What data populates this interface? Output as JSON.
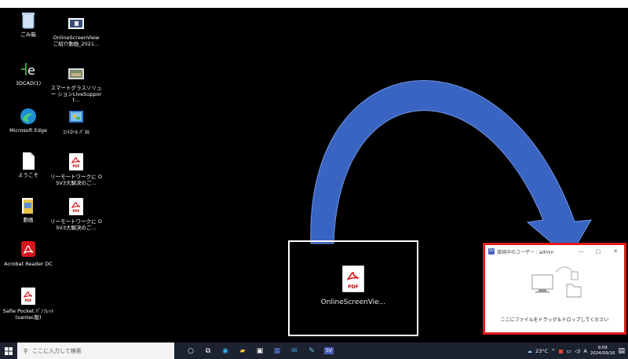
{
  "desktop": {
    "left_column": [
      {
        "label": "ごみ箱",
        "icon": "recycle-bin-icon"
      },
      {
        "label": "3DCAD(1)",
        "icon": "e-app-icon"
      },
      {
        "label": "Microsoft Edge",
        "icon": "edge-icon"
      },
      {
        "label": "ようこそ",
        "icon": "document-icon"
      },
      {
        "label": "動画",
        "icon": "video-folder-icon"
      },
      {
        "label": "Acrobat Reader DC",
        "icon": "acrobat-icon"
      },
      {
        "label": "Safie Pocket ﾊﾟﾝﾌﾚｯﾄ (santec版)",
        "icon": "pdf-icon"
      }
    ],
    "right_column": [
      {
        "label": "OnlineScreenView ご紹介動画_2021...",
        "icon": "video-thumbnail-icon"
      },
      {
        "label": "スマートグラスソリュー ションLiveSupport...",
        "icon": "video-thumbnail-icon"
      },
      {
        "label": "ｺﾝﾄﾛｰﾙ ﾊﾟﾈﾙ",
        "icon": "control-panel-icon"
      },
      {
        "label": "リーモートワークに OSV3大解決のご...",
        "icon": "pdf-icon"
      },
      {
        "label": "リーモートワークに OSV3大解決のご...",
        "icon": "pdf-icon"
      }
    ]
  },
  "pdf_tag": "PDF",
  "dragged_file": {
    "name": "OnlineScreenVie..."
  },
  "sv_window": {
    "logo": "SV",
    "title": "接続中のユーザー : admin",
    "minimize": "—",
    "maximize": "□",
    "close": "✕",
    "drop_message": "ここにファイルをドラッグ＆ドロップしてください"
  },
  "taskbar": {
    "search_placeholder": "ここに入力して検索",
    "apps": [
      {
        "icon": "cortana-icon",
        "glyph": "○"
      },
      {
        "icon": "task-view-icon",
        "glyph": "⧉"
      },
      {
        "icon": "edge-taskbar-icon",
        "glyph": "◉"
      },
      {
        "icon": "file-explorer-icon",
        "glyph": "▰"
      },
      {
        "icon": "store-icon",
        "glyph": "▣"
      },
      {
        "icon": "calendar-icon",
        "glyph": "▦"
      },
      {
        "icon": "mail-icon",
        "glyph": "✉"
      },
      {
        "icon": "notepad-icon",
        "glyph": "✎"
      },
      {
        "icon": "sv-app-icon",
        "glyph": "SV"
      }
    ],
    "weather": "23°C",
    "ime": "A",
    "time": "9:09",
    "date": "2024/09/16"
  },
  "colors": {
    "highlight_border": "#e11b1b",
    "arrow_fill": "#3a64c2",
    "taskbar_bg": "#1c2230"
  }
}
